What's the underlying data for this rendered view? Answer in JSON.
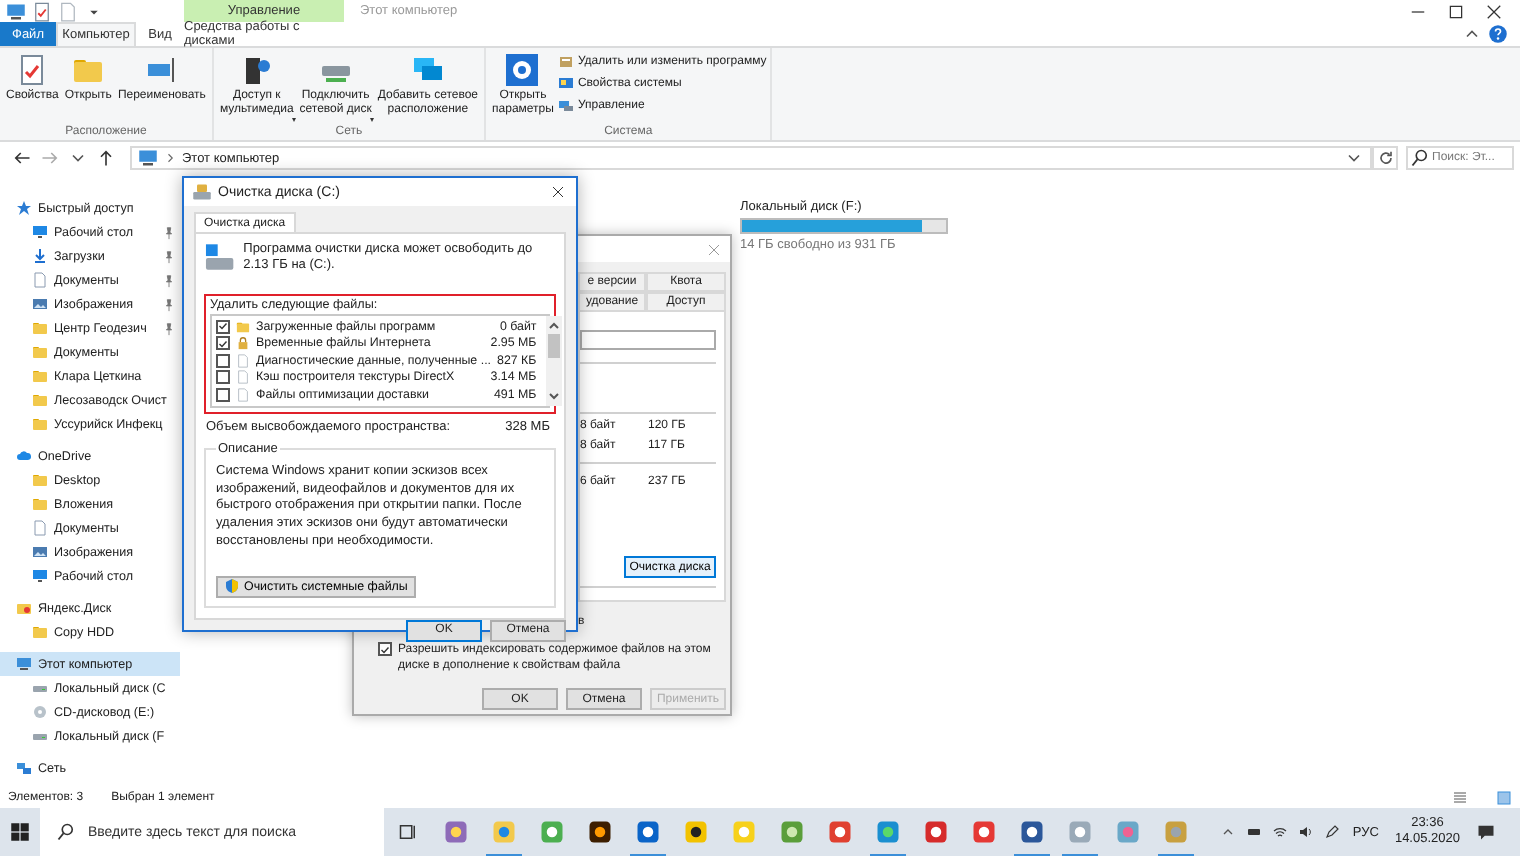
{
  "window": {
    "title": "Этот компьютер",
    "context_tab": "Управление"
  },
  "tabs": [
    {
      "label": "Файл",
      "kind": "file",
      "selected": false
    },
    {
      "label": "Компьютер",
      "kind": "tab",
      "selected": true
    },
    {
      "label": "Вид",
      "kind": "tab",
      "selected": false
    },
    {
      "label": "Средства работы с дисками",
      "kind": "context",
      "selected": false
    }
  ],
  "ribbon": [
    {
      "name": "Расположение",
      "buttons": [
        {
          "lines": [
            "Свойства"
          ],
          "dropdown": false
        },
        {
          "lines": [
            "Открыть"
          ],
          "dropdown": false
        },
        {
          "lines": [
            "Переименовать"
          ],
          "dropdown": false
        }
      ]
    },
    {
      "name": "Сеть",
      "buttons": [
        {
          "lines": [
            "Доступ к",
            "мультимедиа"
          ],
          "dropdown": true
        },
        {
          "lines": [
            "Подключить",
            "сетевой диск"
          ],
          "dropdown": true
        },
        {
          "lines": [
            "Добавить сетевое",
            "расположение"
          ],
          "dropdown": false
        }
      ]
    },
    {
      "name": "Система",
      "buttons": [
        {
          "lines": [
            "Открыть",
            "параметры"
          ],
          "dropdown": false
        }
      ],
      "small_buttons": [
        "Удалить или изменить программу",
        "Свойства системы",
        "Управление"
      ]
    }
  ],
  "address": {
    "path": "Этот компьютер",
    "search_placeholder": "Поиск: Эт..."
  },
  "nav": [
    {
      "label": "Быстрый доступ",
      "selected": false,
      "children": [
        {
          "label": "Рабочий стол",
          "pinned": true,
          "selected": false
        },
        {
          "label": "Загрузки",
          "pinned": true,
          "selected": false
        },
        {
          "label": "Документы",
          "pinned": true,
          "selected": false
        },
        {
          "label": "Изображения",
          "pinned": true,
          "selected": false
        },
        {
          "label": "Центр Геодезич",
          "pinned": true,
          "selected": false
        },
        {
          "label": "Документы",
          "pinned": false,
          "selected": false
        },
        {
          "label": "Клара Цеткина",
          "pinned": false,
          "selected": false
        },
        {
          "label": "Лесозаводск Очист",
          "pinned": false,
          "selected": false
        },
        {
          "label": "Уссурийск Инфекц",
          "pinned": false,
          "selected": false
        }
      ]
    },
    {
      "label": "OneDrive",
      "selected": false,
      "children": [
        {
          "label": "Desktop",
          "selected": false
        },
        {
          "label": "Вложения",
          "selected": false
        },
        {
          "label": "Документы",
          "selected": false
        },
        {
          "label": "Изображения",
          "selected": false
        },
        {
          "label": "Рабочий стол",
          "selected": false
        }
      ]
    },
    {
      "label": "Яндекс.Диск",
      "selected": false,
      "children": [
        {
          "label": "Copy HDD",
          "selected": false
        }
      ]
    },
    {
      "label": "Этот компьютер",
      "selected": true,
      "children": [
        {
          "label": "Локальный диск (С",
          "selected": false
        },
        {
          "label": "CD-дисковод (E:)",
          "selected": false
        },
        {
          "label": "Локальный диск (F",
          "selected": false
        }
      ]
    },
    {
      "label": "Сеть",
      "selected": false
    }
  ],
  "drive": {
    "name": "Локальный диск (F:)",
    "level": 0.88,
    "free": "14 ГБ свободно из 931 ГБ"
  },
  "properties": {
    "tabs": [
      {
        "label": "е версии",
        "selected": false
      },
      {
        "label": "Квота",
        "selected": false
      },
      {
        "label": "удование",
        "selected": false
      },
      {
        "label": "Доступ",
        "selected": false
      }
    ],
    "rows": [
      {
        "bytes": "8 байт",
        "size": "120 ГБ"
      },
      {
        "bytes": "8 байт",
        "size": "117 ГБ"
      },
      {
        "bytes": "6 байт",
        "size": "237 ГБ"
      }
    ],
    "cleanup_button": "Очистка диска",
    "compress_tail": "в",
    "index_option": {
      "label": "Разрешить индексировать содержимое файлов на этом диске в дополнение к свойствам файла",
      "checked": true
    },
    "buttons": [
      {
        "label": "OK",
        "disabled": false
      },
      {
        "label": "Отмена",
        "disabled": false
      },
      {
        "label": "Применить",
        "disabled": true
      }
    ]
  },
  "dialog": {
    "title": "Очистка диска  (C:)",
    "tab": "Очистка диска",
    "intro": "Программа очистки диска может освободить до 2.13 ГБ на (C:).",
    "list_label": "Удалить следующие файлы:",
    "files": [
      {
        "name": "Загруженные файлы программ",
        "size": "0 байт",
        "checked": true
      },
      {
        "name": "Временные файлы Интернета",
        "size": "2.95 МБ",
        "checked": true
      },
      {
        "name": "Диагностические данные, полученные ...",
        "size": "827 КБ",
        "checked": false
      },
      {
        "name": "Кэш построителя текстуры DirectX",
        "size": "3.14 МБ",
        "checked": false
      },
      {
        "name": "Файлы оптимизации доставки",
        "size": "491 МБ",
        "checked": false
      }
    ],
    "total_label": "Объем высвобождаемого пространства:",
    "total": "328 МБ",
    "description_title": "Описание",
    "description": "Система Windows хранит копии эскизов всех изображений, видеофайлов и документов для их быстрого отображения при открытии папки. После удаления этих эскизов они будут автоматически восстановлены при необходимости.",
    "system_button": "Очистить системные файлы",
    "buttons": [
      "OK",
      "Отмена"
    ]
  },
  "status_bar": {
    "count": "Элементов: 3",
    "selection": "Выбран 1 элемент"
  },
  "taskbar": {
    "search_placeholder": "Введите здесь текст для поиска",
    "apps": [
      {
        "running": false
      },
      {
        "running": true
      },
      {
        "running": false
      },
      {
        "running": false
      },
      {
        "running": true
      },
      {
        "running": false
      },
      {
        "running": false
      },
      {
        "running": false
      },
      {
        "running": false
      },
      {
        "running": true
      },
      {
        "running": false
      },
      {
        "running": false
      },
      {
        "running": true
      },
      {
        "running": true
      },
      {
        "running": false
      },
      {
        "running": true
      }
    ],
    "language": "РУС",
    "time": "23:36",
    "date": "14.05.2020"
  }
}
